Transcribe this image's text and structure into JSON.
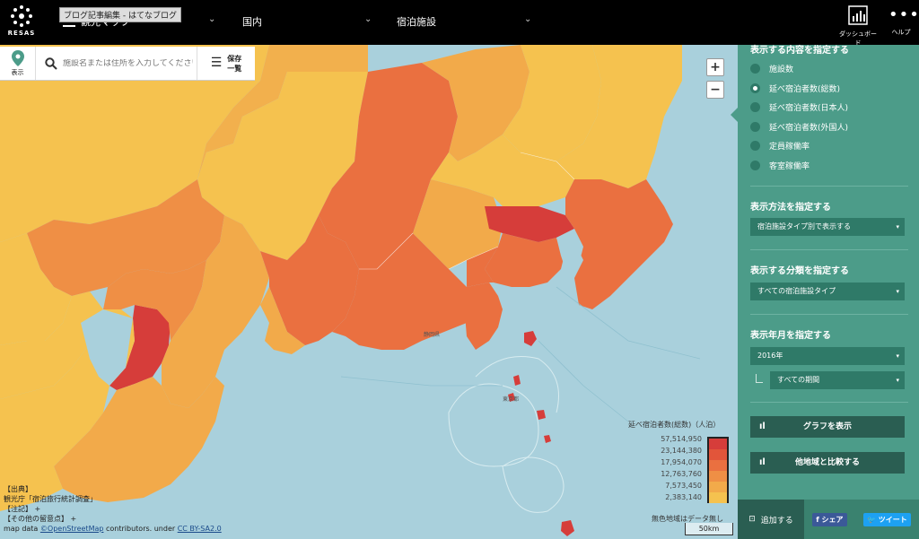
{
  "app": {
    "logo_text": "RESAS",
    "tooltip": "ブログ記事編集 - はてなブログ"
  },
  "header": {
    "menu_label": "観光マップ",
    "region_select": "国内",
    "category_select": "宿泊施設",
    "dashboard_label": "ダッシュボード",
    "help_label": "ヘルプ"
  },
  "toolbar": {
    "display_label": "表示",
    "search_placeholder": "施設名または住所を入力してください",
    "save_label_1": "保存",
    "save_label_2": "一覧"
  },
  "zoom": {
    "in": "+",
    "out": "−"
  },
  "legend": {
    "title": "延べ宿泊者数(総数)（人泊）",
    "values": [
      "57,514,950",
      "23,144,380",
      "17,954,070",
      "12,763,760",
      "7,573,450",
      "2,383,140"
    ],
    "colors": [
      "#d63d3a",
      "#e2553a",
      "#ea7040",
      "#ef8f45",
      "#f2aa4a",
      "#f5c24f"
    ],
    "nodata_label": "無色地域はデータ無し",
    "scale_label": "50km"
  },
  "map": {
    "sea_color": "#a9d0dc",
    "labels": {
      "shizuoka": "静岡県",
      "kanagawa": "東京都"
    }
  },
  "credits": {
    "source_header": "【出典】",
    "source": "観光庁「宿泊旅行統計調査」",
    "notes": "【注記】 +",
    "other": "【その他の留意点】 +",
    "map_data_prefix": "map data ",
    "osm": "©OpenStreetMap",
    "contributors": " contributors. under ",
    "license": "CC BY-SA2.0"
  },
  "panel": {
    "content_title": "表示する内容を指定する",
    "radio_options": [
      {
        "label": "施設数",
        "selected": false
      },
      {
        "label": "延べ宿泊者数(総数)",
        "selected": true
      },
      {
        "label": "延べ宿泊者数(日本人)",
        "selected": false
      },
      {
        "label": "延べ宿泊者数(外国人)",
        "selected": false
      },
      {
        "label": "定員稼働率",
        "selected": false
      },
      {
        "label": "客室稼働率",
        "selected": false
      }
    ],
    "method_title": "表示方法を指定する",
    "method_value": "宿泊施設タイプ別で表示する",
    "category_title": "表示する分類を指定する",
    "category_value": "すべての宿泊施設タイプ",
    "period_title": "表示年月を指定する",
    "year_value": "2016年",
    "period_value": "すべての期間",
    "graph_button": "グラフを表示",
    "compare_button": "他地域と比較する",
    "add_label": "追加する",
    "share_fb": "シェア",
    "share_tw": "ツイート"
  }
}
